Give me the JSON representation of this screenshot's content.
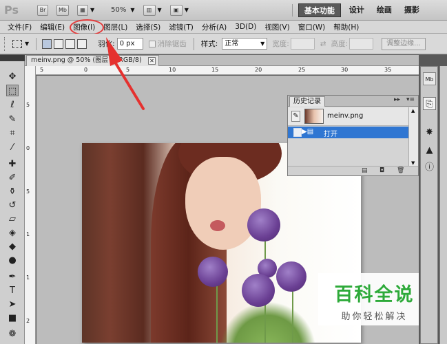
{
  "app": {
    "logo": "Ps",
    "bridge_btn": "Br",
    "minibridge_btn": "Mb",
    "zoom": "50%",
    "workspaces": [
      "基本功能",
      "设计",
      "绘画",
      "摄影"
    ]
  },
  "menu": [
    "文件(F)",
    "编辑(E)",
    "图像(I)",
    "图层(L)",
    "选择(S)",
    "滤镜(T)",
    "分析(A)",
    "3D(D)",
    "视图(V)",
    "窗口(W)",
    "帮助(H)"
  ],
  "options": {
    "feather_label": "羽化:",
    "feather_value": "0 px",
    "antialias_label": "消除锯齿",
    "style_label": "样式:",
    "style_value": "正常",
    "width_label": "宽度:",
    "height_label": "高度:",
    "refine_edge": "调整边缘..."
  },
  "document": {
    "tab_title": "meinv.png @ 50% (图层 1, RGB/8)"
  },
  "ruler": {
    "h_ticks": [
      "5",
      "0",
      "5",
      "10",
      "15",
      "20",
      "25",
      "30",
      "35"
    ],
    "v_ticks": [
      "5",
      "0",
      "5",
      "1",
      "1",
      "2"
    ]
  },
  "history": {
    "tab": "历史记录",
    "snapshot": "meinv.png",
    "state": "打开"
  },
  "watermark": {
    "title": "百科全说",
    "subtitle": "助你轻松解决"
  },
  "colors": {
    "highlight": "#e23a3a",
    "selection": "#2f76d2",
    "watermark_green": "#2eaa3a"
  }
}
